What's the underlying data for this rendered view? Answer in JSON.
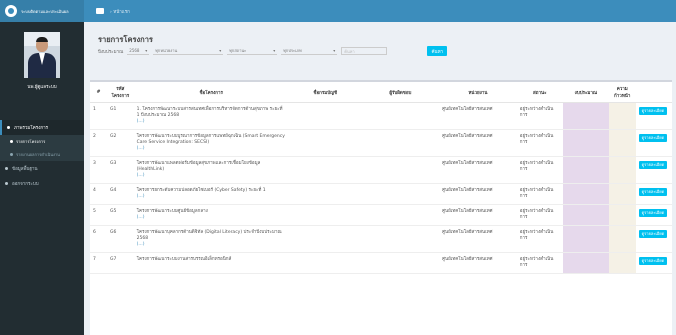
{
  "app": {
    "brand": "ระบบติดตามและประเมินผล"
  },
  "user": {
    "name": "นพ.ผู้ดูแลระบบ"
  },
  "nav": [
    {
      "label": "ภาพรวมโครงการ",
      "active": true
    },
    {
      "label": "รายการโครงการ",
      "sub": true,
      "active": true
    },
    {
      "label": "รายงานผลการดำเนินงาน",
      "sub": true,
      "active": false
    },
    {
      "label": "ข้อมูลพื้นฐาน",
      "active": false
    },
    {
      "label": "ออกจากระบบ",
      "active": false
    }
  ],
  "topbar": {
    "breadcrumb": "› หน้าแรก"
  },
  "page": {
    "title": "รายการโครงการ"
  },
  "filters": {
    "label": "ปีงบประมาณ",
    "year": "2568",
    "unit": "ทุกหน่วยงาน",
    "status": "ทุกสถานะ",
    "type": "ทุกประเภท",
    "search_placeholder": "ค้นหา",
    "search_button": "ค้นหา"
  },
  "table": {
    "headers": [
      "#",
      "รหัส โครงการ",
      "ชื่อโครงการ",
      "ชื่อกรมบัญชี",
      "ผู้รับผิดชอบ",
      "หน่วยงาน",
      "สถานะ",
      "งบประมาณ",
      "ความ ก้าวหน้า",
      ""
    ],
    "rows": [
      {
        "no": "1",
        "code": "G1",
        "title": "1. โครงการพัฒนาระบบสารสนเทศเพื่อการบริหารจัดการด้านสุขภาพ ระยะที่ 1 ปีงบประมาณ 2568",
        "more": "(...)",
        "unit": "ศูนย์เทคโนโลยีสารสนเทศ",
        "status": "อยู่ระหว่างดำเนินการ",
        "btn": "ดูรายละเอียด"
      },
      {
        "no": "2",
        "code": "G2",
        "title": "โครงการพัฒนาระบบบูรณาการข้อมูลการแพทย์ฉุกเฉิน (Smart Emergency Care Service Integration: SECSI)",
        "more": "(...)",
        "unit": "ศูนย์เทคโนโลยีสารสนเทศ",
        "status": "อยู่ระหว่างดำเนินการ",
        "btn": "ดูรายละเอียด"
      },
      {
        "no": "3",
        "code": "G3",
        "title": "โครงการพัฒนาแพลตฟอร์มข้อมูลสุขภาพและการเชื่อมโยงข้อมูล (HealthLink)",
        "more": "(...)",
        "unit": "ศูนย์เทคโนโลยีสารสนเทศ",
        "status": "อยู่ระหว่างดำเนินการ",
        "btn": "ดูรายละเอียด"
      },
      {
        "no": "4",
        "code": "G4",
        "title": "โครงการยกระดับความปลอดภัยไซเบอร์ (Cyber Safety) ระยะที่ 1",
        "more": "(...)",
        "unit": "ศูนย์เทคโนโลยีสารสนเทศ",
        "status": "อยู่ระหว่างดำเนินการ",
        "btn": "ดูรายละเอียด"
      },
      {
        "no": "5",
        "code": "G5",
        "title": "โครงการพัฒนาระบบศูนย์ข้อมูลกลาง",
        "more": "(...)",
        "unit": "ศูนย์เทคโนโลยีสารสนเทศ",
        "status": "อยู่ระหว่างดำเนินการ",
        "btn": "ดูรายละเอียด"
      },
      {
        "no": "6",
        "code": "G6",
        "title": "โครงการพัฒนาบุคลากรด้านดิจิทัล (Digital Literacy) ประจำปีงบประมาณ 2568",
        "more": "(...)",
        "unit": "ศูนย์เทคโนโลยีสารสนเทศ",
        "status": "อยู่ระหว่างดำเนินการ",
        "btn": "ดูรายละเอียด"
      },
      {
        "no": "7",
        "code": "G7",
        "title": "โครงการพัฒนาระบบงานสารบรรณอิเล็กทรอนิกส์",
        "more": "",
        "unit": "ศูนย์เทคโนโลยีสารสนเทศ",
        "status": "อยู่ระหว่างดำเนินการ",
        "btn": "ดูรายละเอียด"
      }
    ]
  },
  "colors": {
    "topbar": "#3c8dbc",
    "sidebar": "#222d32",
    "button": "#00c0ef",
    "col_budget": "#e6d9ec",
    "col_progress": "#f5f1e6"
  }
}
